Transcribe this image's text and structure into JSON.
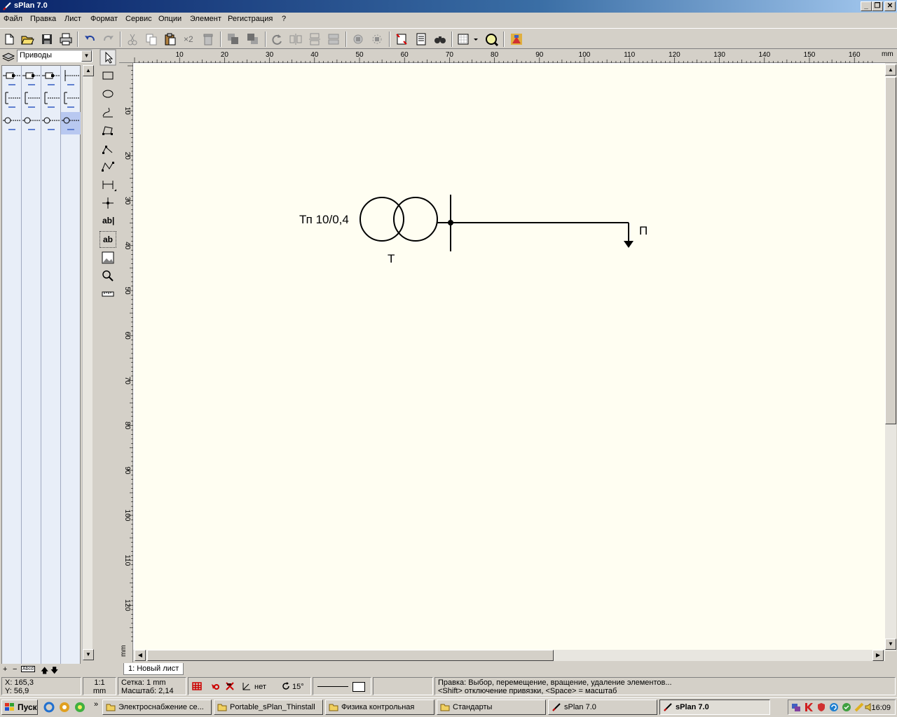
{
  "window": {
    "title": "sPlan 7.0",
    "caption_buttons": [
      "minimize",
      "maximize",
      "close"
    ]
  },
  "menu": [
    "Файл",
    "Правка",
    "Лист",
    "Формат",
    "Сервис",
    "Опции",
    "Элемент",
    "Регистрация",
    "?"
  ],
  "toolbar": {
    "buttons": [
      "new-icon",
      "open-icon",
      "save-icon",
      "print-icon",
      "undo-icon",
      "redo-icon",
      "cut-icon",
      "copy-icon",
      "paste-icon",
      "duplicate-icon",
      "delete-icon",
      "to-front-icon",
      "to-back-icon",
      "rotate-icon",
      "mirror-h-icon",
      "mirror-v-icon",
      "mirror-icon",
      "group-icon",
      "ungroup-icon",
      "snap-icon",
      "parts-list-icon",
      "find-icon",
      "grid-icon",
      "zoom-icon",
      "library-icon"
    ],
    "duplicate_label": "×2"
  },
  "library": {
    "selected": "Приводы",
    "selected_cell": 11,
    "footer_label": "Abcd"
  },
  "drawtools": {
    "items": [
      "pointer-icon",
      "rectangle-icon",
      "ellipse-icon",
      "bezier-icon",
      "polygon-icon",
      "polyline-icon",
      "spline-icon",
      "dimension-icon",
      "junction-icon",
      "text-icon",
      "text-frame-icon",
      "image-icon",
      "zoom-icon",
      "measure-icon"
    ],
    "text_label": "ab|",
    "text_frame_label": "ab"
  },
  "ruler": {
    "unit": "mm",
    "top_ticks": [
      "10",
      "20",
      "30",
      "40",
      "50",
      "60",
      "70",
      "80",
      "90",
      "100",
      "110",
      "120",
      "130",
      "140",
      "150",
      "160"
    ],
    "left_ticks": [
      "10",
      "20",
      "30",
      "40",
      "50",
      "60",
      "70",
      "80",
      "90",
      "100",
      "110",
      "120"
    ]
  },
  "drawing": {
    "transformer_label": "Тп 10/0,4",
    "transformer_ref": "Т",
    "load_label": "П"
  },
  "sheet_tab": "1: Новый лист",
  "status": {
    "x_coord": "X: 165,3",
    "y_coord": "Y: 56,9",
    "scale_ratio": "1:1",
    "scale_unit": "mm",
    "grid": "Сетка: 1 mm",
    "zoom": "Масштаб:  2,14",
    "angle_snap_label": "нет",
    "rotation_label": "15°",
    "hint_line1": "Правка: Выбор, перемещение, вращение, удаление элементов...",
    "hint_line2": "<Shift> отключение привязки, <Space> = масштаб"
  },
  "taskbar": {
    "start_label": "Пуск",
    "quick_chevron": "»",
    "tasks": [
      {
        "label": "Электроснабжение се...",
        "icon": "folder-icon",
        "active": false
      },
      {
        "label": "Portable_sPlan_Thinstall",
        "icon": "folder-icon",
        "active": false
      },
      {
        "label": "Физика контрольная",
        "icon": "folder-icon",
        "active": false
      },
      {
        "label": "Стандарты",
        "icon": "folder-icon",
        "active": false
      },
      {
        "label": "sPlan 7.0",
        "icon": "splan-icon",
        "active": false
      },
      {
        "label": "sPlan 7.0",
        "icon": "splan-icon",
        "active": true
      }
    ],
    "clock": "16:09"
  }
}
